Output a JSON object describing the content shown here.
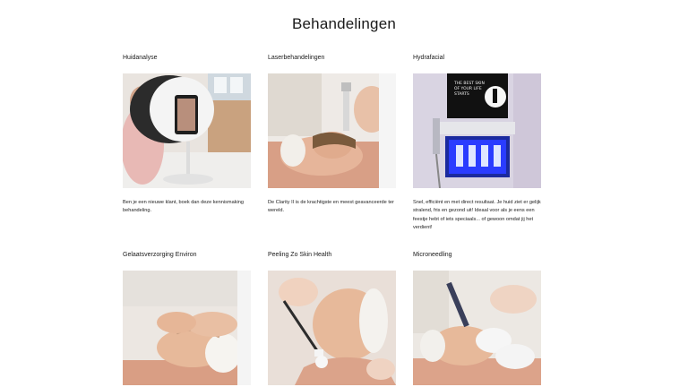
{
  "page": {
    "title": "Behandelingen"
  },
  "treatments": [
    {
      "title": "Huidanalyse",
      "image": "skin-analysis-device-photo",
      "description": "Ben je een nieuwe klant, boek dan deze kennismaking behandeling."
    },
    {
      "title": "Laserbehandelingen",
      "image": "laser-treatment-photo",
      "description": "De Clarity II is de krachtigste en meest geavanceerde ter wereld."
    },
    {
      "title": "Hydrafacial",
      "image": "hydrafacial-machine-photo",
      "screen_text": [
        "THE BEST SKIN",
        "OF YOUR LIFE",
        "STARTS"
      ],
      "description": "Snel, efficiënt en met direct resultaat. Je huid ziet er gelijk stralend, fris en gezond uit! Ideaal voor als je eens een feestje hebt of iets speciaals... of gewoon omdat jij het verdient!"
    },
    {
      "title": "Gelaatsverzorging Environ",
      "image": "environ-facial-massage-photo",
      "description": ""
    },
    {
      "title": "Peeling Zo Skin Health",
      "image": "peeling-brush-application-photo",
      "description": ""
    },
    {
      "title": "Microneedling",
      "image": "microneedling-pen-photo",
      "description": ""
    }
  ],
  "colors": {
    "background": "#ffffff",
    "text": "#1a1a1a",
    "hydrafacial_glow": "#2a3cff",
    "skin_tone": "#e7b99a"
  }
}
